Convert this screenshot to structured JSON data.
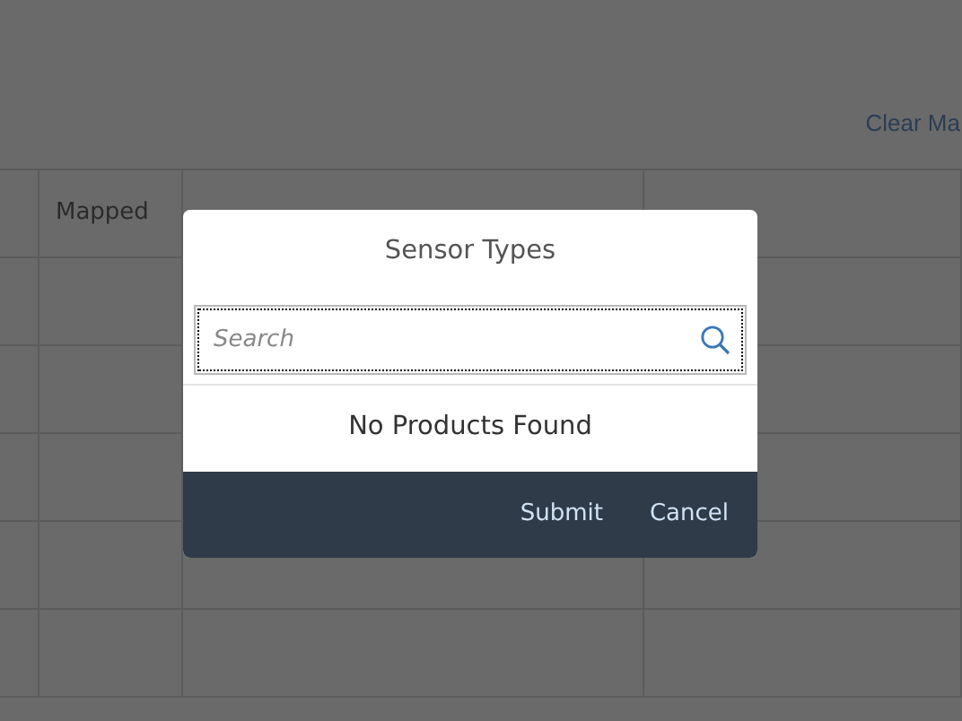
{
  "toolbar": {
    "link": "Clear Ma"
  },
  "table": {
    "columns": [
      "Mapped"
    ]
  },
  "dialog": {
    "title": "Sensor Types",
    "search": {
      "placeholder": "Search"
    },
    "message": "No Products Found",
    "buttons": [
      "Submit",
      "Cancel"
    ]
  }
}
